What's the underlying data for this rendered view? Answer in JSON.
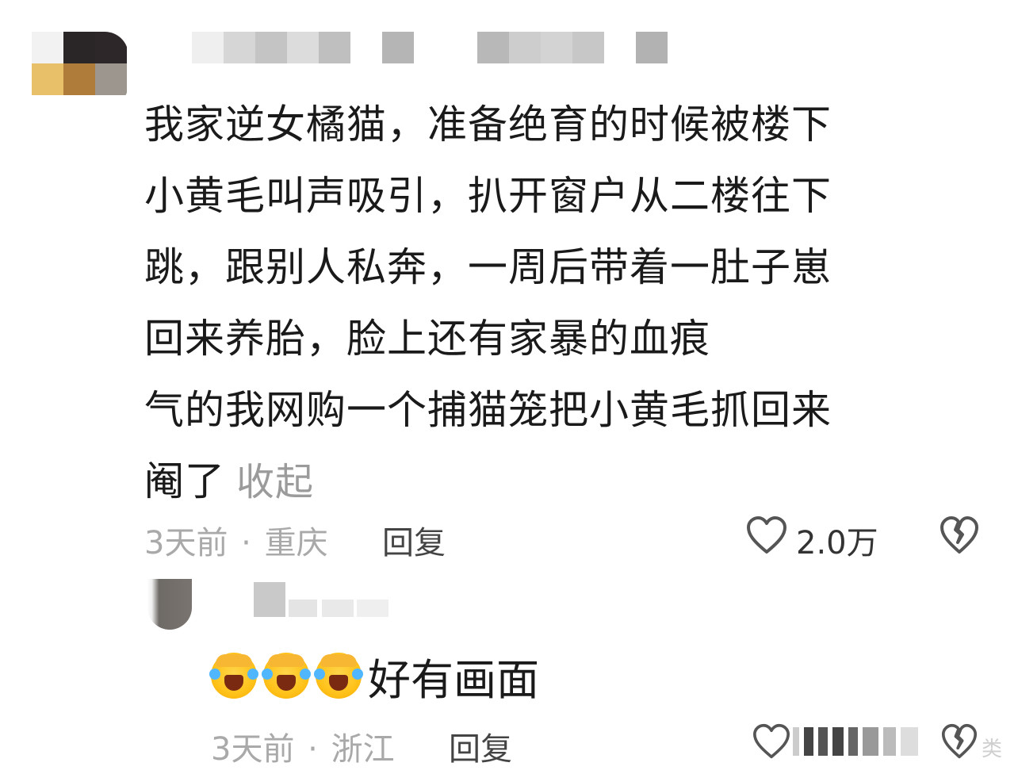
{
  "comment": {
    "lines": [
      "我家逆女橘猫，准备绝育的时候被楼下",
      "小黄毛叫声吸引，扒开窗户从二楼往下",
      "跳，跟别人私奔，一周后带着一肚子崽",
      "回来养胎，脸上还有家暴的血痕",
      "气的我网购一个捕猫笼把小黄毛抓回来",
      "阉了"
    ],
    "collapse_label": "收起",
    "time": "3天前",
    "separator": "·",
    "location": "重庆",
    "reply_label": "回复",
    "like_count": "2.0万",
    "like_icon": "heart-outline-icon",
    "dislike_icon": "broken-heart-icon"
  },
  "reply": {
    "emoji_name": "facepalm-laugh-cry-emoji",
    "emoji_count": 3,
    "text": "好有画面",
    "time": "3天前",
    "separator": "·",
    "location": "浙江",
    "reply_label": "回复",
    "corner_text": "类"
  },
  "colors": {
    "text_primary": "#1a1a1a",
    "text_muted": "#a9a9a9",
    "reply_button": "#444444",
    "icon_stroke": "#555555"
  }
}
